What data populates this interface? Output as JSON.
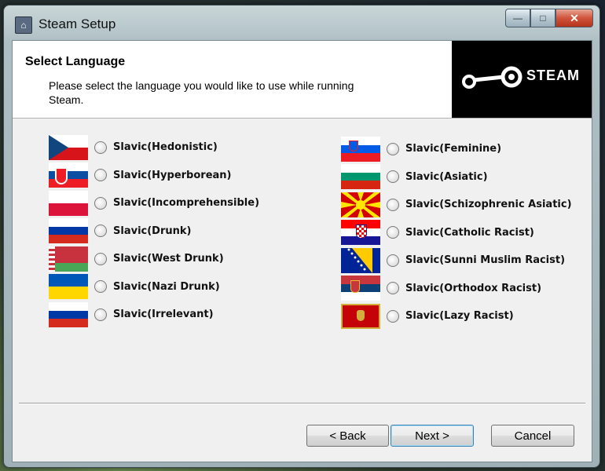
{
  "window": {
    "title": "Steam Setup",
    "controls": {
      "minimize": "—",
      "maximize": "□",
      "close": "✕"
    }
  },
  "header": {
    "title": "Select Language",
    "subtitle": "Please select the language you would like to use while running Steam.",
    "logo_text": "STEAM"
  },
  "languages_left": [
    {
      "label": "Slavic(Hedonistic)",
      "flag": "czech"
    },
    {
      "label": "Slavic(Hyperborean)",
      "flag": "slovakia"
    },
    {
      "label": "Slavic(Incomprehensible)",
      "flag": "poland"
    },
    {
      "label": "Slavic(Drunk)",
      "flag": "russia"
    },
    {
      "label": "Slavic(West Drunk)",
      "flag": "belarus"
    },
    {
      "label": "Slavic(Nazi Drunk)",
      "flag": "ukraine"
    },
    {
      "label": "Slavic(Irrelevant)",
      "flag": "russia"
    }
  ],
  "languages_right": [
    {
      "label": "Slavic(Feminine)",
      "flag": "slovenia"
    },
    {
      "label": "Slavic(Asiatic)",
      "flag": "bulgaria"
    },
    {
      "label": "Slavic(Schizophrenic Asiatic)",
      "flag": "macedonia"
    },
    {
      "label": "Slavic(Catholic Racist)",
      "flag": "croatia"
    },
    {
      "label": "Slavic(Sunni Muslim Racist)",
      "flag": "bosnia"
    },
    {
      "label": "Slavic(Orthodox Racist)",
      "flag": "serbia"
    },
    {
      "label": "Slavic(Lazy Racist)",
      "flag": "montenegro"
    }
  ],
  "buttons": {
    "back": "< Back",
    "next": "Next >",
    "cancel": "Cancel"
  }
}
